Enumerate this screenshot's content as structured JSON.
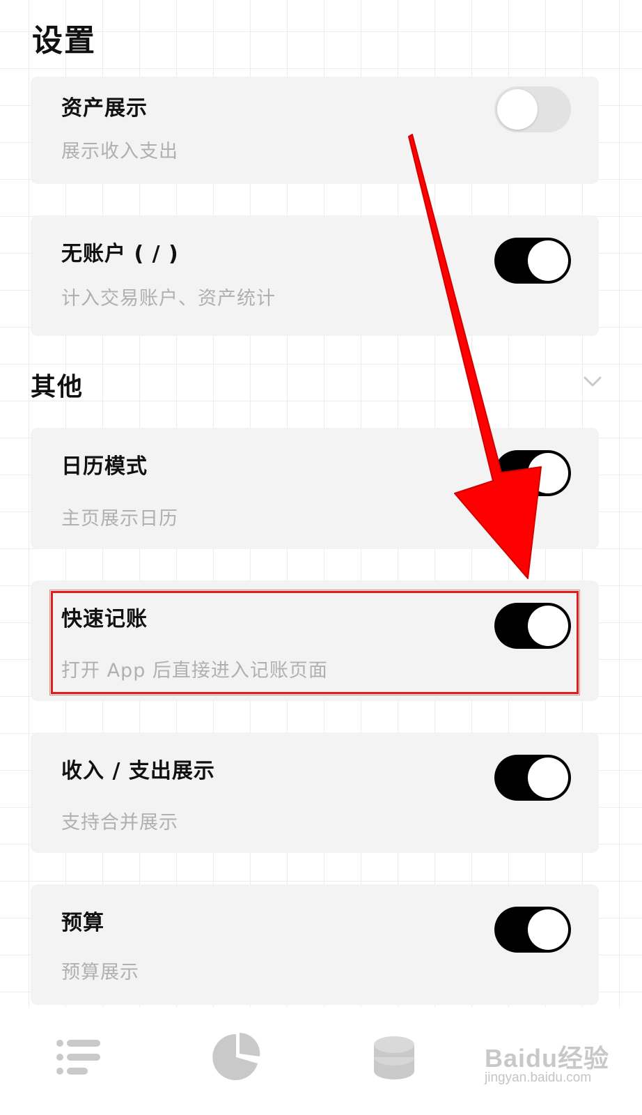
{
  "header": {
    "title": "设置"
  },
  "cards_top": [
    {
      "title": "资产展示",
      "subtitle": "展示收入支出",
      "toggle_on": false
    },
    {
      "title": "无账户 ( / )",
      "subtitle": "计入交易账户、资产统计",
      "toggle_on": true
    }
  ],
  "section": {
    "title": "其他",
    "chevron_icon": "chevron-down-icon"
  },
  "cards_other": [
    {
      "title": "日历模式",
      "subtitle": "主页展示日历",
      "toggle_on": true
    },
    {
      "title": "快速记账",
      "subtitle": "打开 App 后直接进入记账页面",
      "toggle_on": true,
      "highlighted": true
    },
    {
      "title": "收入 / 支出展示",
      "subtitle": "支持合并展示",
      "toggle_on": true
    },
    {
      "title": "预算",
      "subtitle": "预算展示",
      "toggle_on": true
    }
  ],
  "tabbar": {
    "tabs": [
      {
        "icon": "list-icon"
      },
      {
        "icon": "pie-chart-icon"
      },
      {
        "icon": "coins-stack-icon"
      }
    ]
  },
  "watermark": {
    "brand": "Baidu经验",
    "url": "jingyan.baidu.com"
  },
  "colors": {
    "toggle_on": "#000000",
    "toggle_off": "#e2e2e2",
    "card_bg": "#f3f3f3",
    "annotation": "#ff0000"
  }
}
